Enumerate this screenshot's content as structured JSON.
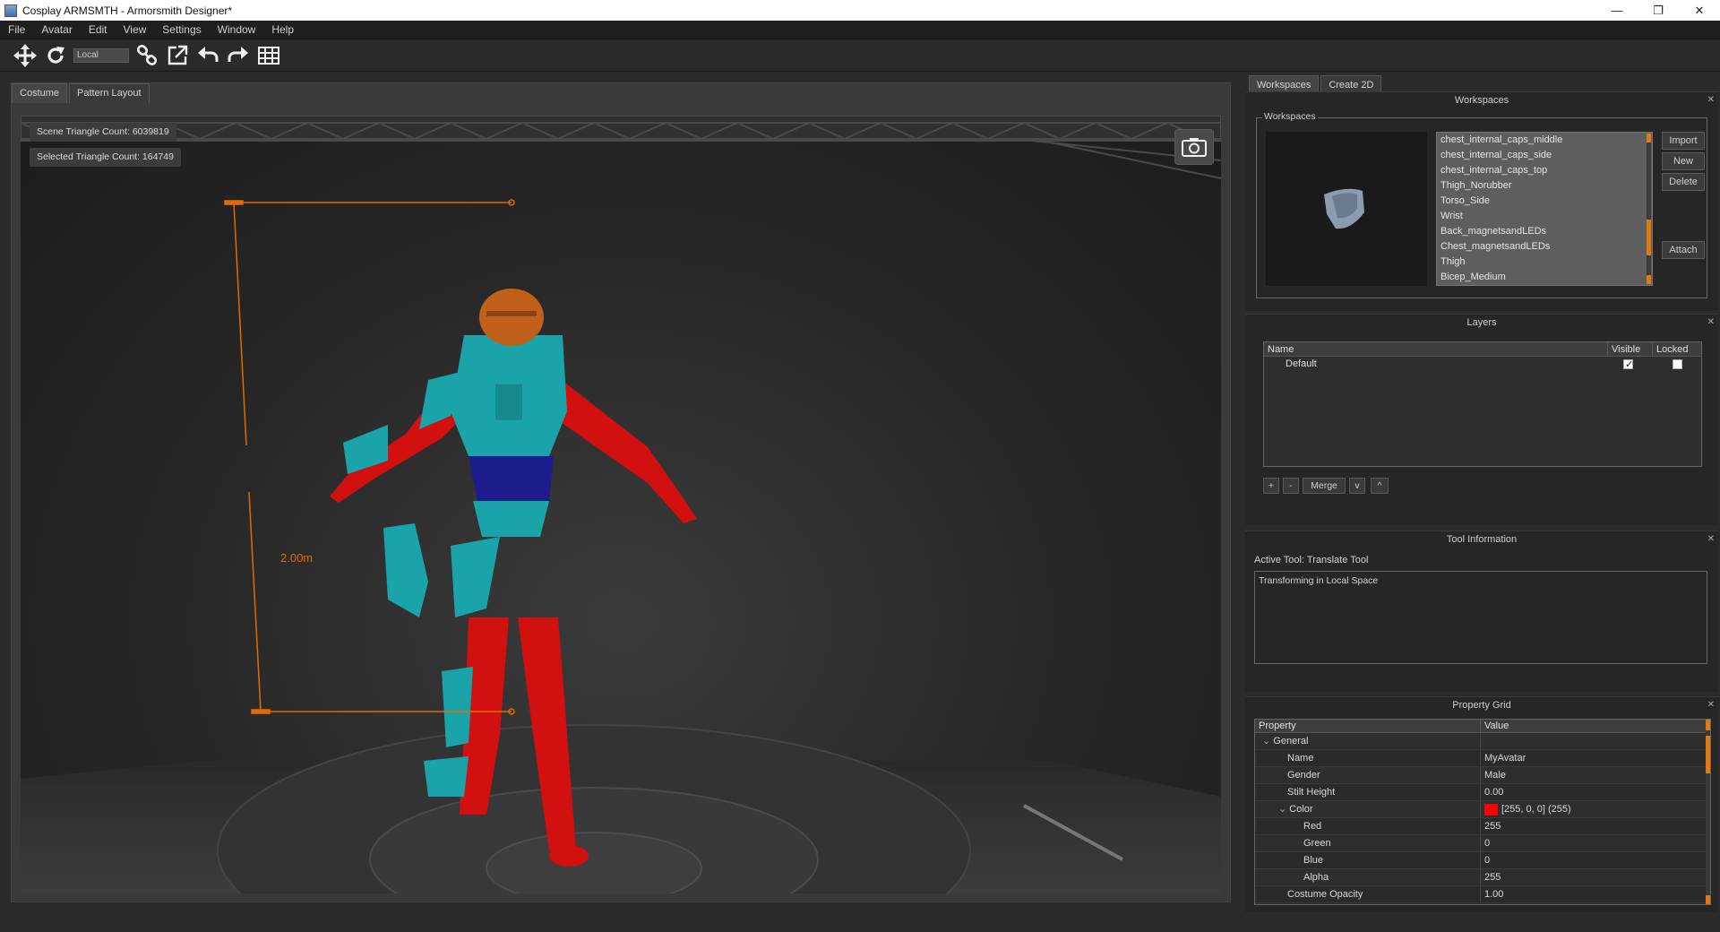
{
  "window": {
    "title": "Cosplay ARMSMTH - Armorsmith Designer*",
    "minimize": "—",
    "maximize": "❐",
    "close": "✕"
  },
  "menu": [
    "File",
    "Avatar",
    "Edit",
    "View",
    "Settings",
    "Window",
    "Help"
  ],
  "toolbar": {
    "space_mode": "Local",
    "icons": [
      "move-icon",
      "rotate-icon",
      "link-icon",
      "external-link-icon",
      "undo-icon",
      "redo-icon",
      "grid-icon"
    ]
  },
  "left_tabs": [
    "Costume",
    "Pattern Layout"
  ],
  "viewport": {
    "scene_triangles": "Scene Triangle Count: 6039819",
    "selected_triangles": "Selected Triangle Count: 164749",
    "height_label": "2.00m",
    "measure_color": "#e36a00"
  },
  "right_tabs": [
    "Workspaces",
    "Create 2D"
  ],
  "workspaces": {
    "title": "Workspaces",
    "group_label": "Workspaces",
    "items": [
      "chest_internal_caps_middle",
      "chest_internal_caps_side",
      "chest_internal_caps_top",
      "Thigh_Norubber",
      "Torso_Side",
      "Wrist",
      "Back_magnetsandLEDs",
      "Chest_magnetsandLEDs",
      "Thigh",
      "Bicep_Medium"
    ],
    "buttons": {
      "import": "Import",
      "new": "New",
      "delete": "Delete",
      "attach": "Attach"
    }
  },
  "layers": {
    "title": "Layers",
    "columns": {
      "name": "Name",
      "visible": "Visible",
      "locked": "Locked"
    },
    "rows": [
      {
        "name": "Default",
        "visible": true,
        "locked": false
      }
    ],
    "buttons": {
      "add": "+",
      "remove": "-",
      "merge": "Merge",
      "down": "v",
      "up": "^"
    }
  },
  "tool_info": {
    "title": "Tool Information",
    "active_tool": "Active Tool: Translate Tool",
    "description": "Transforming in Local Space"
  },
  "property_grid": {
    "title": "Property Grid",
    "columns": {
      "property": "Property",
      "value": "Value"
    },
    "rows": [
      {
        "name": "General",
        "value": "",
        "indent": 0,
        "expander": true
      },
      {
        "name": "Name",
        "value": "MyAvatar",
        "indent": 1
      },
      {
        "name": "Gender",
        "value": "Male",
        "indent": 1
      },
      {
        "name": "Stilt Height",
        "value": "0.00",
        "indent": 1
      },
      {
        "name": "Color",
        "value": "[255, 0, 0] (255)",
        "indent": 1,
        "expander": true,
        "swatch": "#ff0000"
      },
      {
        "name": "Red",
        "value": "255",
        "indent": 2
      },
      {
        "name": "Green",
        "value": "0",
        "indent": 2
      },
      {
        "name": "Blue",
        "value": "0",
        "indent": 2
      },
      {
        "name": "Alpha",
        "value": "255",
        "indent": 2
      },
      {
        "name": "Costume Opacity",
        "value": "1.00",
        "indent": 1
      }
    ]
  },
  "colors": {
    "accent": "#e07a10",
    "armor_teal": "#1aa3a8",
    "armor_red": "#d21010",
    "armor_blue": "#1c1c8c",
    "helmet": "#c0601a"
  }
}
